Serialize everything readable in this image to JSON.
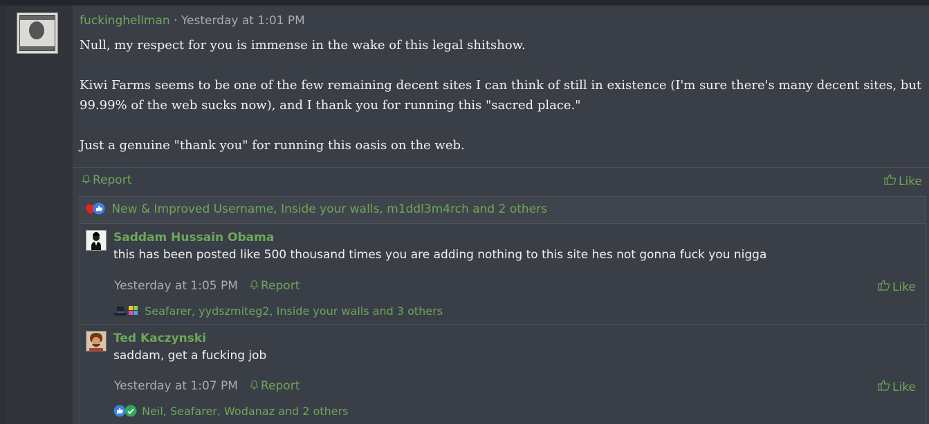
{
  "post": {
    "username": "fuckinghellman",
    "separator": " · ",
    "timestamp": "Yesterday at 1:01 PM",
    "body": [
      "Null, my respect for you is immense in the wake of this legal shitshow.",
      "Kiwi Farms seems to be one of the few remaining decent sites I can think of still in existence (I'm sure there's many decent sites, but 99.99% of the web sucks now), and I thank you for running this \"sacred place.\"",
      "Just a genuine \"thank you\" for running this oasis on the web."
    ],
    "report_label": "Report",
    "like_label": "Like",
    "reactions_text": "New & Improved Username, Inside your walls, m1ddl3m4rch and 2 others"
  },
  "replies": [
    {
      "username": "Saddam Hussain Obama",
      "text": "this has been posted like 500 thousand times you are adding nothing to this site hes not gonna fuck you nigga",
      "timestamp": "Yesterday at 1:05 PM",
      "report_label": "Report",
      "like_label": "Like",
      "reactions_text": "Seafarer, yydszmiteg2, Inside your walls and 3 others"
    },
    {
      "username": "Ted Kaczynski",
      "text": "saddam, get a fucking job",
      "timestamp": "Yesterday at 1:07 PM",
      "report_label": "Report",
      "like_label": "Like",
      "reactions_text": "Neil, Seafarer, Wodanaz and 2 others"
    }
  ],
  "colors": {
    "accent_green": "#6da85a",
    "background": "#2c2f36",
    "post_background": "#3a3e46",
    "muted_text": "#a9abae"
  },
  "icons": {
    "report": "bell-icon",
    "like": "thumbs-up-icon",
    "heart": "heart-reaction-icon",
    "like_reaction": "like-reaction-icon"
  }
}
